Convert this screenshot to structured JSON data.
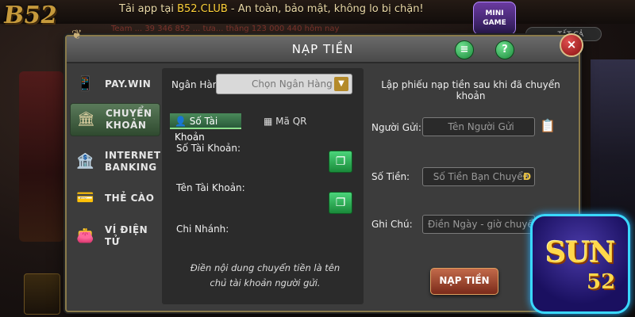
{
  "background": {
    "banner_prefix": "Tải app tại ",
    "banner_club": "B52.CLUB",
    "banner_suffix": " - An toàn, bảo mật, không lo bị chặn!",
    "logo": "B52",
    "minigame": "MINI GAME",
    "filter_pill": "TẤT CẢ",
    "ticker": "Team ... 39 346 852 ... tưa... thắng 123 000 440 hôm nay"
  },
  "dialog": {
    "title": "NẠP TIỀN",
    "close_label": "×",
    "help_label": "?"
  },
  "sidebar": {
    "items": [
      {
        "label": "PAY.WIN",
        "icon": "phone-money-icon",
        "glyph": "📱",
        "active": false
      },
      {
        "label": "CHUYỂN KHOẢN",
        "icon": "bank-icon",
        "glyph": "🏛",
        "active": true
      },
      {
        "label": "INTERNET BANKING",
        "icon": "mobile-bank-icon",
        "glyph": "🏦",
        "active": false
      },
      {
        "label": "THẺ CÀO",
        "icon": "card-icon",
        "glyph": "💳",
        "active": false
      },
      {
        "label": "VÍ ĐIỆN TỬ",
        "icon": "wallet-icon",
        "glyph": "👛",
        "active": false
      }
    ]
  },
  "transfer": {
    "bank_label": "Ngân Hàng:",
    "bank_placeholder": "Chọn Ngân Hàng",
    "tabs": [
      {
        "label": "Số Tài Khoản",
        "icon": "person-icon",
        "active": true
      },
      {
        "label": "Mã QR",
        "icon": "qr-icon",
        "active": false
      }
    ],
    "account_number_label": "Số Tài Khoản:",
    "account_name_label": "Tên Tài Khoản:",
    "branch_label": "Chi Nhánh:",
    "note": "Điền nội dung chuyển tiền là tên chủ tài khoản người gửi."
  },
  "form": {
    "hint": "Lập phiếu nạp tiền sau khi đã chuyển khoản",
    "sender_label": "Người Gửi:",
    "sender_placeholder": "Tên Người Gửi",
    "amount_label": "Số Tiền:",
    "amount_placeholder": "Số Tiền Bạn Chuyển",
    "currency": "Đ",
    "note_label": "Ghi Chú:",
    "note_placeholder": "Điền Ngày - giờ chuyển tiền",
    "submit_label": "NẠP TIỀN"
  },
  "badge": {
    "brand": "SUN",
    "number": "52"
  }
}
